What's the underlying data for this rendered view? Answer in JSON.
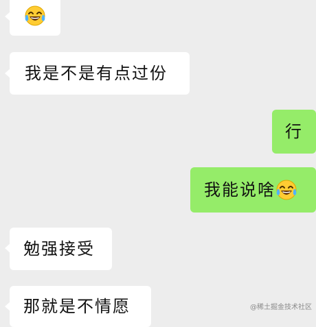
{
  "messages": [
    {
      "side": "incoming",
      "text": "",
      "emoji": "face-with-tears-of-joy-icon"
    },
    {
      "side": "incoming",
      "text": "我是不是有点过份"
    },
    {
      "side": "outgoing",
      "text": "行"
    },
    {
      "side": "outgoing",
      "text": "我能说啥",
      "emoji": "face-with-tears-of-joy-icon"
    },
    {
      "side": "incoming",
      "text": "勉强接受"
    },
    {
      "side": "incoming",
      "text": "那就是不情愿"
    }
  ],
  "watermark": "@稀土掘金技术社区",
  "colors": {
    "background": "#ededed",
    "incoming_bubble": "#ffffff",
    "outgoing_bubble": "#95ec69"
  }
}
